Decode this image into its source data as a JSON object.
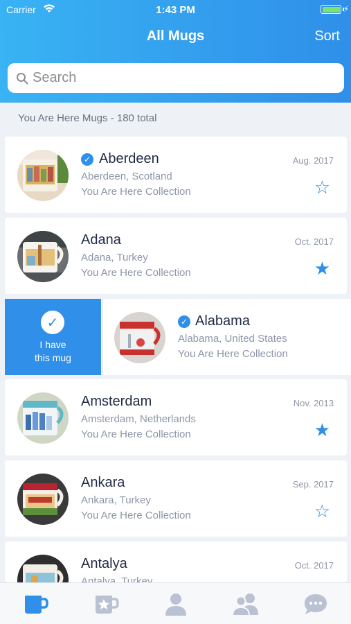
{
  "status_bar": {
    "carrier": "Carrier",
    "time": "1:43 PM"
  },
  "nav": {
    "title": "All Mugs",
    "sort_label": "Sort"
  },
  "search": {
    "placeholder": "Search"
  },
  "section": {
    "label": "You Are Here Mugs - 180 total"
  },
  "rows": [
    {
      "name": "Aberdeen",
      "location": "Aberdeen, Scotland",
      "collection": "You Are Here Collection",
      "date": "Aug. 2017",
      "verified": true,
      "favorite": false,
      "star": "☆"
    },
    {
      "name": "Adana",
      "location": "Adana, Turkey",
      "collection": "You Are Here Collection",
      "date": "Oct. 2017",
      "verified": false,
      "favorite": true,
      "star": "★"
    },
    {
      "name": "Alabama",
      "location": "Alabama, United States",
      "collection": "You Are Here Collection",
      "date": "",
      "verified": true,
      "favorite": false,
      "star": ""
    },
    {
      "name": "Amsterdam",
      "location": "Amsterdam, Netherlands",
      "collection": "You Are Here Collection",
      "date": "Nov. 2013",
      "verified": false,
      "favorite": true,
      "star": "★"
    },
    {
      "name": "Ankara",
      "location": "Ankara, Turkey",
      "collection": "You Are Here Collection",
      "date": "Sep. 2017",
      "verified": false,
      "favorite": false,
      "star": "☆"
    },
    {
      "name": "Antalya",
      "location": "Antalya, Turkey",
      "collection": "",
      "date": "Oct. 2017",
      "verified": false,
      "favorite": false,
      "star": ""
    }
  ],
  "swipe_action": {
    "line1": "I have",
    "line2": "this mug",
    "check": "✓"
  },
  "badge": {
    "check": "✓"
  },
  "tabs": [
    {
      "icon": "mug-icon",
      "active": true
    },
    {
      "icon": "favorite-mug-icon",
      "active": false
    },
    {
      "icon": "profile-icon",
      "active": false
    },
    {
      "icon": "friends-icon",
      "active": false
    },
    {
      "icon": "chat-icon",
      "active": false
    }
  ],
  "colors": {
    "accent": "#2f8fe9",
    "header_start": "#39b3f4",
    "header_end": "#2f8fe9",
    "muted_text": "#8f96a8",
    "inactive_tab": "#b9c1d2"
  }
}
